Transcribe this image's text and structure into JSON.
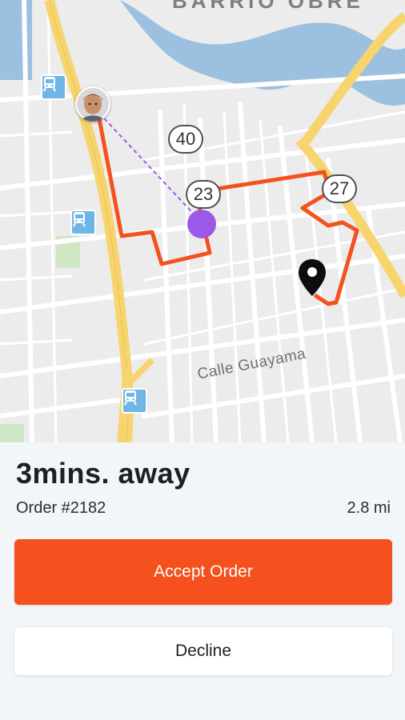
{
  "map": {
    "district_label": "BARRIO OBRE",
    "street_label": "Calle Guayama",
    "route_shields": [
      "40",
      "23",
      "27"
    ],
    "icons": {
      "transit": "transit-station-icon",
      "courier": "avatar",
      "driver": "driver-location-dot",
      "destination": "map-pin-icon"
    }
  },
  "trip": {
    "eta": "3mins. away",
    "order": "Order #2182",
    "distance": "2.8 mi"
  },
  "actions": {
    "accept_label": "Accept Order",
    "decline_label": "Decline"
  },
  "colors": {
    "accent": "#f4511e",
    "route": "#f4511e",
    "driver_dot": "#9b59e8",
    "water": "#9cc0e0",
    "highway": "#f7d46e"
  }
}
